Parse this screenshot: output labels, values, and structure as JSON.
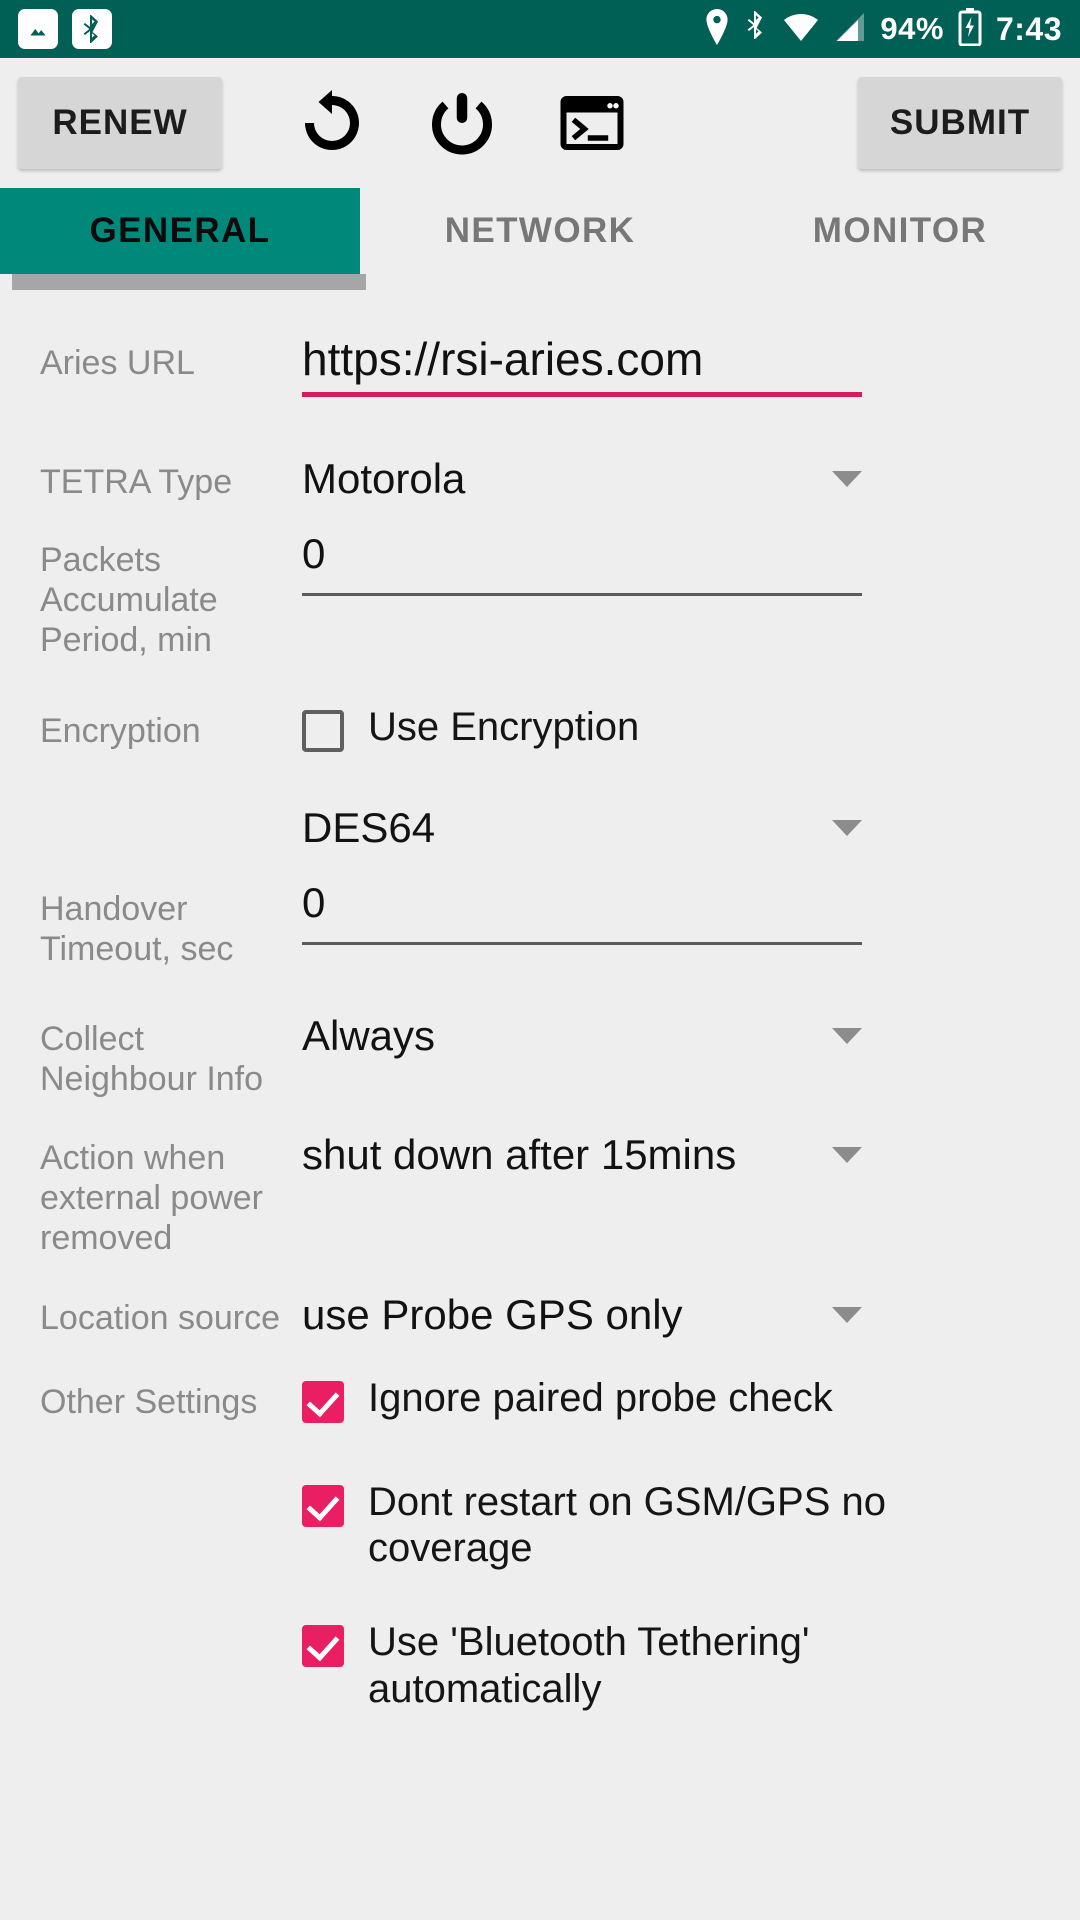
{
  "statusbar": {
    "left_icons": [
      "photo-icon",
      "bluetooth-notification-icon"
    ],
    "right_icons": [
      "location-icon",
      "bluetooth-icon",
      "wifi-icon",
      "cellular-signal-icon"
    ],
    "battery_percent": "94%",
    "battery_icon": "battery-charging-icon",
    "clock": "7:43",
    "background": "#006055"
  },
  "toolbar": {
    "renew_label": "RENEW",
    "submit_label": "SUBMIT",
    "icons": [
      "restart-icon",
      "power-icon",
      "terminal-icon"
    ]
  },
  "tabs": [
    {
      "label": "GENERAL",
      "active": true
    },
    {
      "label": "NETWORK",
      "active": false
    },
    {
      "label": "MONITOR",
      "active": false
    }
  ],
  "accent": {
    "tab_active": "#00897b",
    "field_underline": "#d81b60",
    "checkbox_checked": "#e91e63"
  },
  "form": {
    "aries_url": {
      "label": "Aries URL",
      "value": "https://rsi-aries.com"
    },
    "tetra_type": {
      "label": "TETRA Type",
      "value": "Motorola"
    },
    "packets_period": {
      "label": "Packets Accumulate Period, min",
      "value": "0"
    },
    "encryption": {
      "label": "Encryption",
      "checkbox_label": "Use Encryption",
      "checked": false,
      "algorithm": "DES64"
    },
    "handover_timeout": {
      "label": "Handover Timeout, sec",
      "value": "0"
    },
    "collect_neighbour": {
      "label": "Collect Neighbour Info",
      "value": "Always"
    },
    "power_action": {
      "label": "Action when external power removed",
      "value": "shut down after 15mins"
    },
    "location_source": {
      "label": "Location source",
      "value": "use Probe GPS only"
    },
    "other_settings": {
      "label": "Other Settings",
      "items": [
        {
          "text": "Ignore paired probe check",
          "checked": true
        },
        {
          "text": "Dont restart on GSM/GPS no coverage",
          "checked": true
        },
        {
          "text": "Use 'Bluetooth Tethering' automatically",
          "checked": true
        }
      ]
    }
  }
}
